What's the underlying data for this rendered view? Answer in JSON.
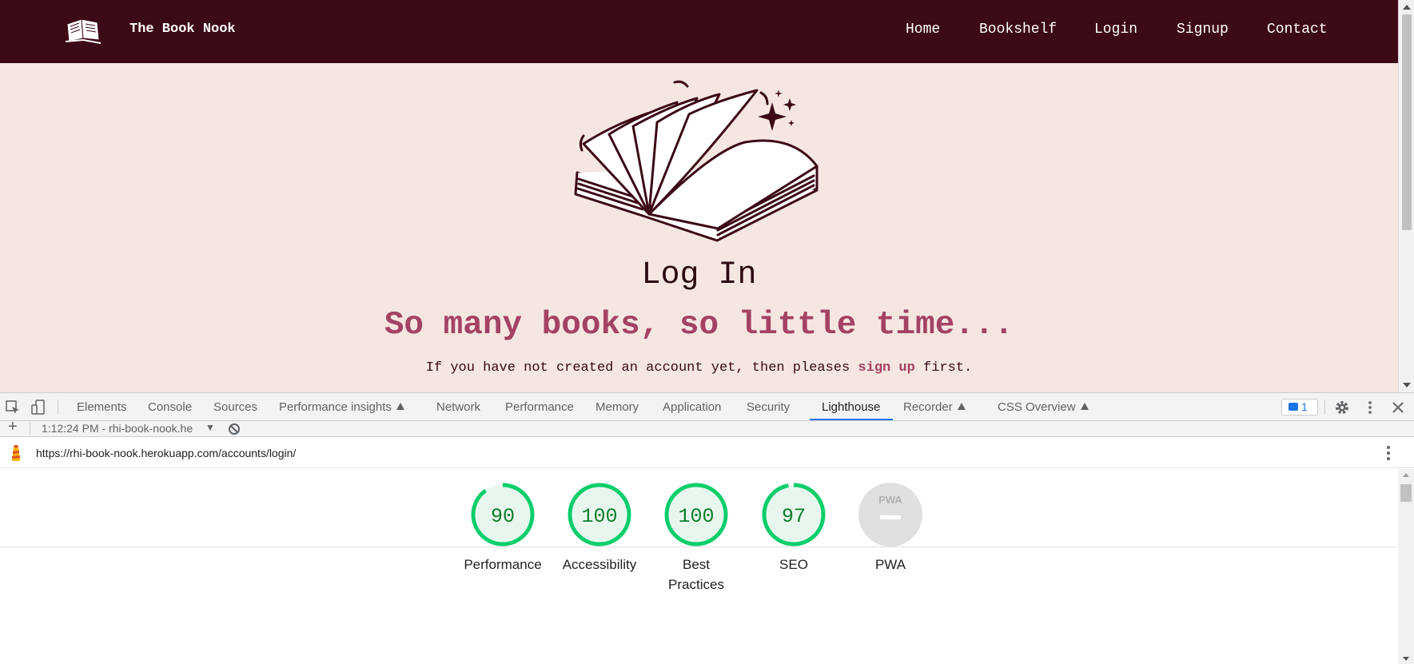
{
  "site": {
    "brand": "The Book Nook",
    "nav": [
      "Home",
      "Bookshelf",
      "Login",
      "Signup",
      "Contact"
    ],
    "heading": "Log In",
    "tagline": "So many books, so little time...",
    "note_before": "If you have not created an account yet, then pleases ",
    "note_link": "sign up",
    "note_after": " first."
  },
  "devtools": {
    "tabs": [
      "Elements",
      "Console",
      "Sources",
      "Performance insights",
      "Network",
      "Performance",
      "Memory",
      "Application",
      "Security",
      "Lighthouse",
      "Recorder",
      "CSS Overview"
    ],
    "active_tab": "Lighthouse",
    "issues_count": "1",
    "report_select": "1:12:24 PM - rhi-book-nook.he",
    "url": "https://rhi-book-nook.herokuapp.com/accounts/login/"
  },
  "lighthouse": {
    "scores": [
      {
        "label": "Performance",
        "value": 90
      },
      {
        "label": "Accessibility",
        "value": 100
      },
      {
        "label": "Best Practices",
        "value": 100
      },
      {
        "label": "SEO",
        "value": 97
      },
      {
        "label": "PWA",
        "value": null,
        "badge": "PWA"
      }
    ],
    "colors": {
      "pass": "#0cce6b",
      "pass_bg": "#e8f7ee",
      "pass_text": "#0c7d2b",
      "na": "#e0e0e0"
    }
  },
  "colors": {
    "nav_bg": "#3c0916",
    "page_bg": "#f5e6e2",
    "accent": "#a44263"
  }
}
